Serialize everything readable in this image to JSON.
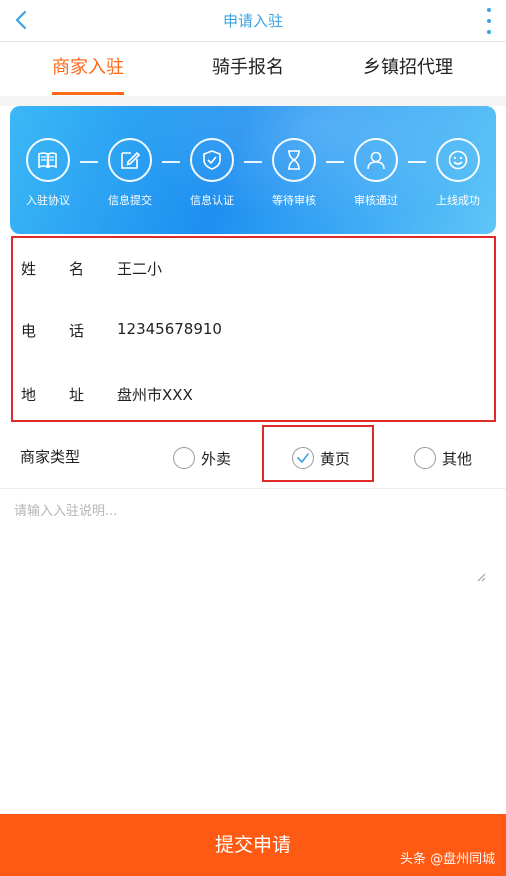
{
  "header": {
    "title": "申请入驻",
    "back_icon": "chevron-left-icon",
    "more_icon": "vertical-dots-icon",
    "accent_color": "#3aa3e0"
  },
  "tabs": [
    {
      "label": "商家入驻",
      "active": true
    },
    {
      "label": "骑手报名",
      "active": false
    },
    {
      "label": "乡镇招代理",
      "active": false
    }
  ],
  "tab_active_color": "#ff6a1a",
  "steps": [
    {
      "label": "入驻协议",
      "icon": "book-icon"
    },
    {
      "label": "信息提交",
      "icon": "edit-icon"
    },
    {
      "label": "信息认证",
      "icon": "shield-check-icon"
    },
    {
      "label": "等待审核",
      "icon": "hourglass-icon"
    },
    {
      "label": "审核通过",
      "icon": "user-icon"
    },
    {
      "label": "上线成功",
      "icon": "smile-icon"
    }
  ],
  "form": {
    "name": {
      "label_1": "姓",
      "label_2": "名",
      "value": "王二小"
    },
    "phone": {
      "label_1": "电",
      "label_2": "话",
      "value": "12345678910"
    },
    "address": {
      "label_1": "地",
      "label_2": "址",
      "value": "盘州市XXX"
    }
  },
  "merchant_type": {
    "label": "商家类型",
    "options": [
      {
        "label": "外卖",
        "selected": false
      },
      {
        "label": "黄页",
        "selected": true
      },
      {
        "label": "其他",
        "selected": false
      }
    ]
  },
  "description": {
    "placeholder": "请输入入驻说明...",
    "value": ""
  },
  "submit_label": "提交申请",
  "submit_color": "#ff5a14",
  "watermark": "头条 @盘州同城"
}
